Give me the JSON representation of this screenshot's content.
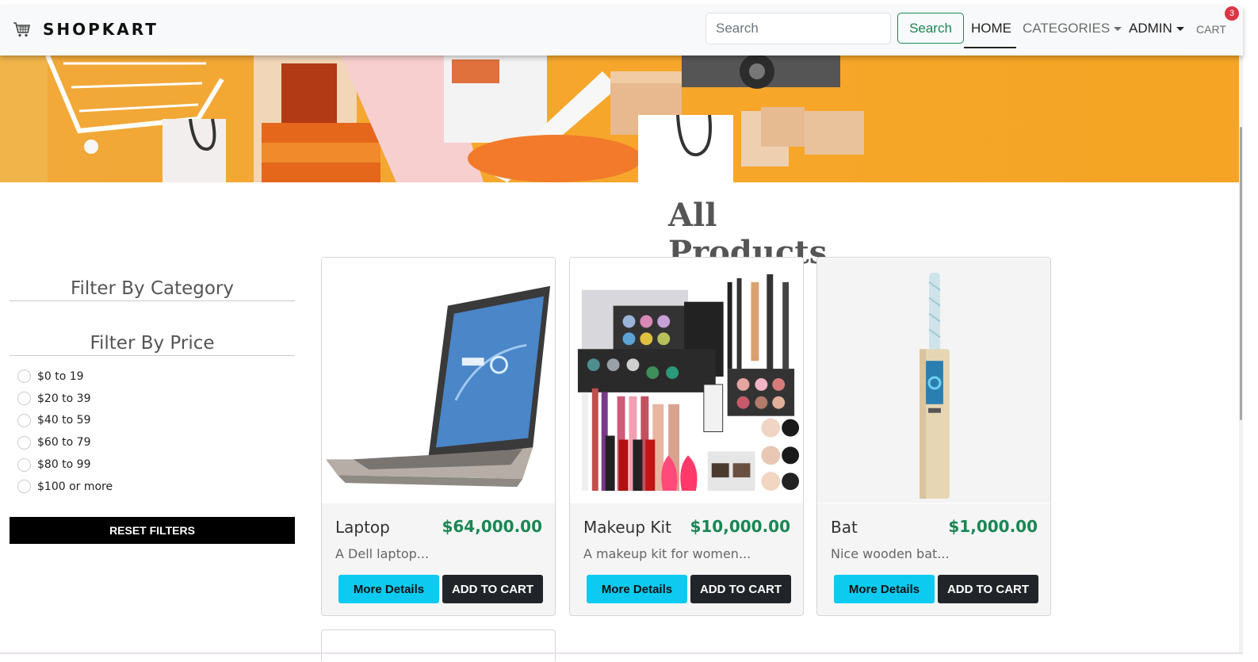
{
  "navbar": {
    "brand": "SHOPKART",
    "search_placeholder": "Search",
    "search_button": "Search",
    "links": {
      "home": "HOME",
      "categories": "CATEGORIES",
      "admin": "ADMIN",
      "cart": "CART"
    },
    "cart_count": "3",
    "logo_icon": "shopping-cart-icon"
  },
  "banner": {
    "icon": "shopping-illustration",
    "accent": "#f5a523"
  },
  "main": {
    "title": "All Products"
  },
  "sidebar": {
    "category_heading": "Filter By Category",
    "price_heading": "Filter By Price",
    "price_options": [
      "$0 to 19",
      "$20 to 39",
      "$40 to 59",
      "$60 to 79",
      "$80 to 99",
      "$100 or more"
    ],
    "reset_button": "RESET FILTERS"
  },
  "products": [
    {
      "name": "Laptop",
      "price": "$64,000.00",
      "description": "A Dell laptop...",
      "details_button": "More Details",
      "cart_button": "ADD TO CART",
      "image": "laptop-image"
    },
    {
      "name": "Makeup Kit",
      "price": "$10,000.00",
      "description": "A makeup kit for women...",
      "details_button": "More Details",
      "cart_button": "ADD TO CART",
      "image": "makeup-kit-image"
    },
    {
      "name": "Bat",
      "price": "$1,000.00",
      "description": "Nice wooden bat...",
      "details_button": "More Details",
      "cart_button": "ADD TO CART",
      "image": "cricket-bat-image"
    }
  ],
  "colors": {
    "price_green": "#198754",
    "details_cyan": "#0dcaf0",
    "cart_dark": "#212529",
    "badge_red": "#dc3545"
  }
}
